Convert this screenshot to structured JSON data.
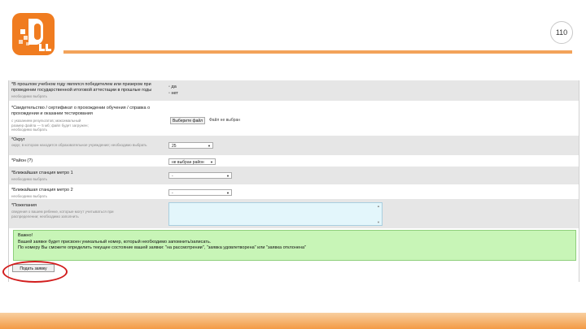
{
  "header": {
    "page_number": "110",
    "logo_icon": "dl-logo-icon",
    "accent_color": "#f07c20"
  },
  "form": {
    "rows": [
      {
        "label": "*В прошлом учебном году являлся победителем или призером при проведении государственной итоговой аттестации в прошлые годы",
        "hint": "необходимо выбрать",
        "options": [
          "да",
          "нет"
        ]
      },
      {
        "label": "*Свидетельство / сертификат о прохождении обучения / справка о прохождении и оказании тестирования",
        "hint": "с указанием результатов; максимальный размер файла — 5 мб; файл будет загружен; необходимо выбрать",
        "file_button": "Выберите файл",
        "file_status": "Файл не выбран"
      },
      {
        "label": "*Округ",
        "hint": "округ, в котором находится образовательное учреждение; необходимо выбрать",
        "select_value": "25"
      },
      {
        "label": "*Район",
        "hint": "",
        "select_value": "не выбран район"
      },
      {
        "label": "*Ближайшая станция метро 1",
        "hint": "необходимо выбрать",
        "select_value": "-"
      },
      {
        "label": "*Ближайшая станция метро 2",
        "hint": "необходимо выбрать",
        "select_value": "-"
      },
      {
        "label": "*Пожелания",
        "hint": "сведения о вашем ребенке, которые могут учитываться при распределении; необходимо заполнить"
      }
    ],
    "notice": {
      "title": "Важно!",
      "line1": "Вашей заявке будет присвоен уникальный номер, который необходимо запомнить/записать.",
      "line2": "По номеру Вы сможете определить текущее состояние вашей заявки: \"на рассмотрении\", \"заявка удовлетворена\" или \"заявка отклонена\""
    },
    "submit_label": "Подать заявку",
    "highlight_color": "#d21d1d"
  }
}
